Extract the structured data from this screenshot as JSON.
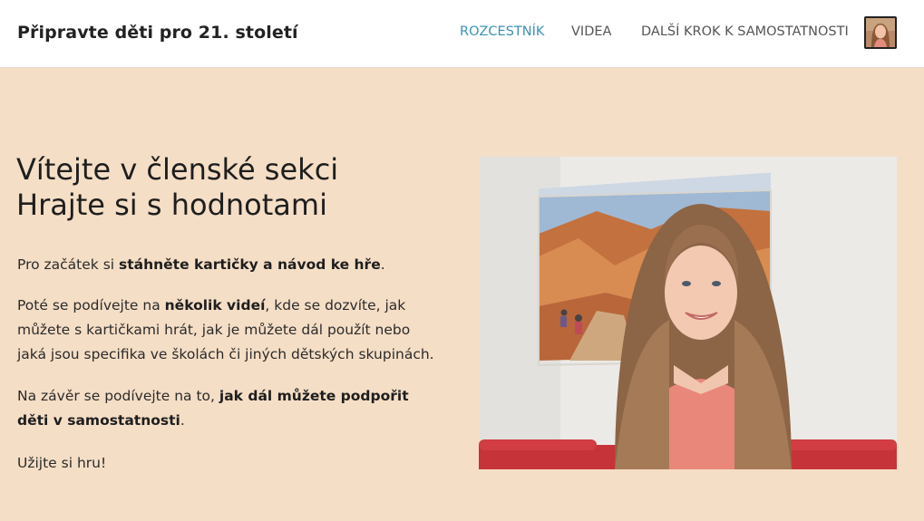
{
  "header": {
    "site_title": "Připravte děti pro 21. století",
    "nav": [
      {
        "label": "ROZCESTNÍK",
        "active": true
      },
      {
        "label": "VIDEA",
        "active": false
      },
      {
        "label": "DALŠÍ KROK K SAMOSTATNOSTI",
        "active": false
      }
    ],
    "accent_color": "#3a93b5"
  },
  "hero": {
    "heading_line1": "Vítejte v členské sekci",
    "heading_line2": "Hrajte si s hodnotami",
    "p1_a": "Pro začátek si ",
    "p1_b": "stáhněte kartičky a návod ke hře",
    "p1_c": ".",
    "p2_a": "Poté se podívejte na ",
    "p2_b": "několik videí",
    "p2_c": ", kde se dozvíte, jak můžete s kartičkami hrát, jak je můžete dál použít nebo jaká jsou specifika ve školách či jiných dětských skupinách.",
    "p3_a": "Na závěr se podívejte na to, ",
    "p3_b": "jak dál můžete podpořit děti v samostatnosti",
    "p3_c": ".",
    "p4": "Užijte si hru!"
  },
  "background_color": "#f5dec6"
}
